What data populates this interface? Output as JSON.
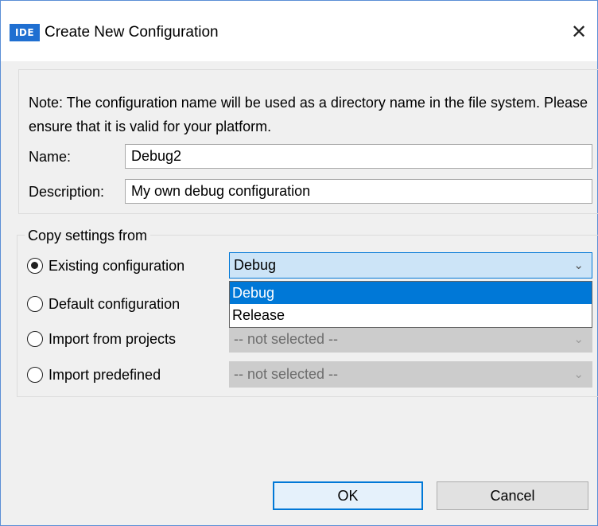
{
  "window": {
    "app_icon": "IDE",
    "title": "Create New Configuration",
    "close_glyph": "✕"
  },
  "note": "Note: The configuration name will be used as a directory name in the file system.  Please ensure that it is valid for your platform.",
  "name": {
    "label": "Name:",
    "value": "Debug2"
  },
  "description": {
    "label": "Description:",
    "value": "My own debug configuration"
  },
  "copy_settings": {
    "title": "Copy settings from",
    "options": [
      {
        "label": "Existing configuration",
        "checked": true,
        "combo_value": "Debug",
        "enabled": true
      },
      {
        "label": "Default configuration",
        "checked": false
      },
      {
        "label": "Import from projects",
        "checked": false,
        "combo_value": "-- not selected --",
        "enabled": false
      },
      {
        "label": "Import predefined",
        "checked": false,
        "combo_value": "-- not selected --",
        "enabled": false
      }
    ],
    "dropdown_items": [
      "Debug",
      "Release"
    ],
    "dropdown_selected": "Debug"
  },
  "buttons": {
    "ok": "OK",
    "cancel": "Cancel"
  },
  "colors": {
    "accent": "#0078d7",
    "logo": "#1f6fd1",
    "combo_active_bg": "#cce4f7",
    "disabled_bg": "#cccccc"
  },
  "icons": {
    "close": "close-icon",
    "chevron": "chevron-down-icon",
    "radio": "radio-button"
  }
}
